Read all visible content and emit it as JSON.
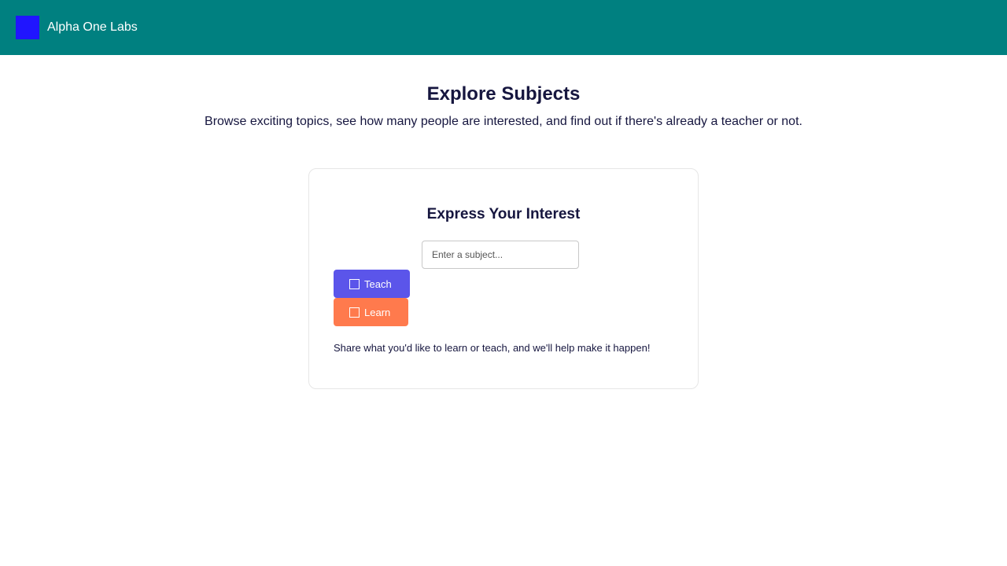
{
  "header": {
    "brand_name": "Alpha One Labs",
    "logo_icon": "logo-square-icon",
    "background_color": "#008080",
    "logo_color": "#2015ff"
  },
  "hero": {
    "title": "Explore Subjects",
    "subtitle": "Browse exciting topics, see how many people are interested, and find out if there's already a teacher or not."
  },
  "interest_card": {
    "title": "Express Your Interest",
    "subject_input": {
      "value": "",
      "placeholder": "Enter a subject..."
    },
    "buttons": {
      "teach": {
        "label": "Teach",
        "icon": "checkbox-icon",
        "checked": false,
        "color": "#5b55ea"
      },
      "learn": {
        "label": "Learn",
        "icon": "checkbox-icon",
        "checked": false,
        "color": "#ff7a4d"
      }
    },
    "note": "Share what you'd like to learn or teach, and we'll help make it happen!"
  }
}
